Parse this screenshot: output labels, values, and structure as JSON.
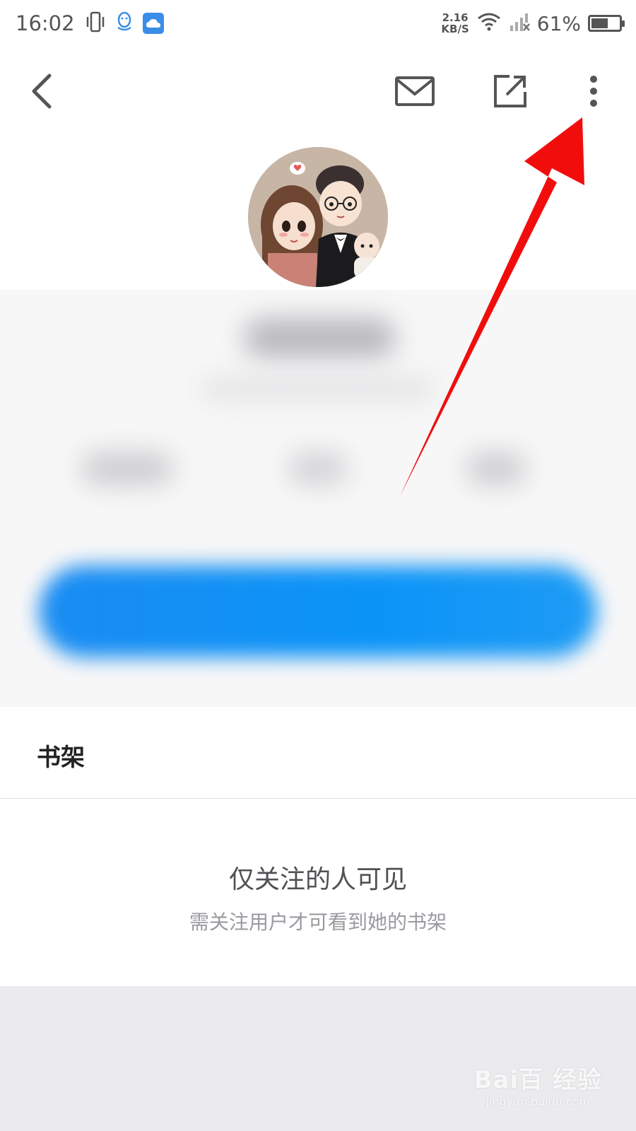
{
  "status_bar": {
    "time": "16:02",
    "net_speed_value": "2.16",
    "net_speed_unit": "KB/S",
    "battery_percent": "61%",
    "battery_level": 0.61
  },
  "nav": {
    "icons": [
      "back-icon",
      "mail-icon",
      "share-icon",
      "more-icon"
    ]
  },
  "profile": {
    "avatar": "avatar-couple-illustration"
  },
  "bookshelf": {
    "title": "书架",
    "empty_title": "仅关注的人可见",
    "empty_subtitle": "需关注用户才可看到她的书架"
  },
  "watermark": {
    "main": "Bai百 经验",
    "url": "jingyan.baidu.com"
  },
  "colors": {
    "accent_blue": "#1a8cf2",
    "annotation_red": "#f20d0d"
  }
}
